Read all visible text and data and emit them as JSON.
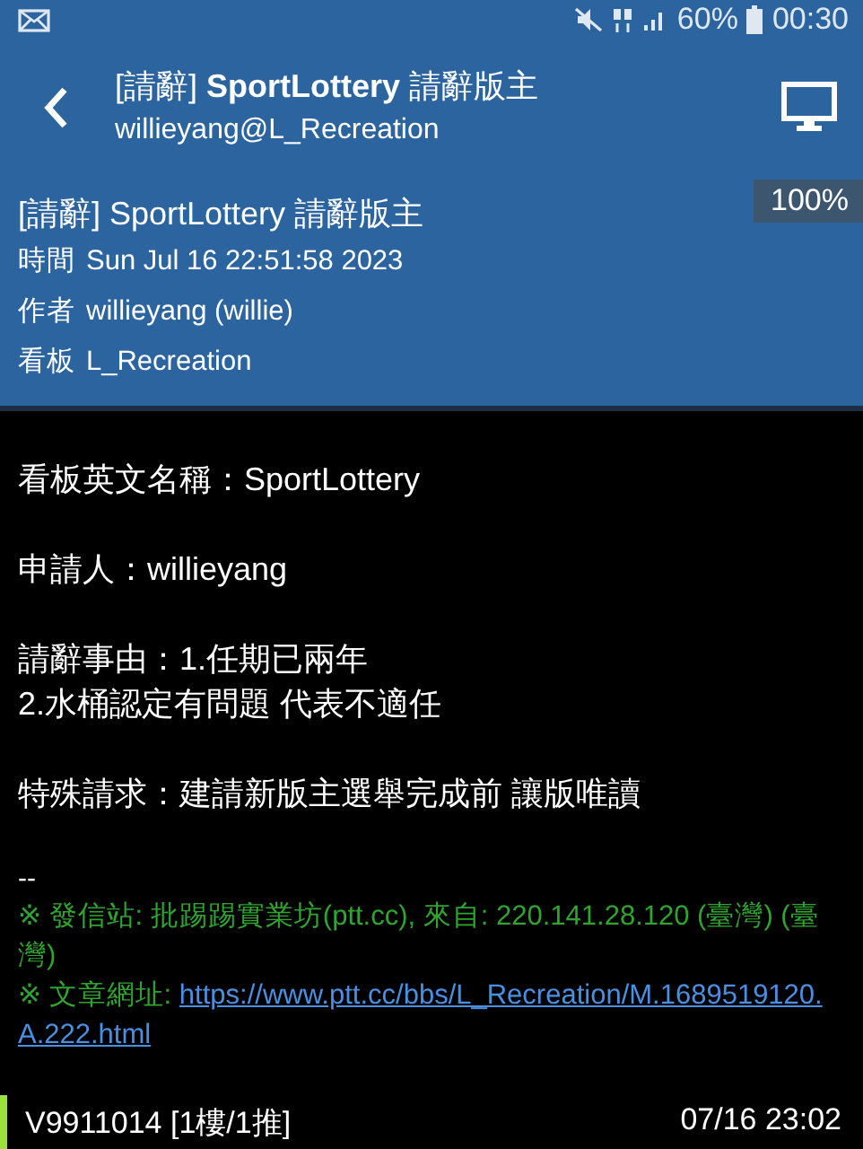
{
  "status_bar": {
    "battery": "60%",
    "time": "00:30"
  },
  "app_bar": {
    "title": "[請辭] **SportLottery** 請辭版主",
    "subtitle": "willieyang@L_Recreation"
  },
  "article_header": {
    "title": "[請辭] SportLottery 請辭版主",
    "zoom": "100%",
    "fields": [
      {
        "label": "時間",
        "value": "Sun Jul 16 22:51:58 2023"
      },
      {
        "label": "作者",
        "value": "willieyang (willie)"
      },
      {
        "label": "看板",
        "value": "L_Recreation"
      }
    ]
  },
  "body": {
    "paragraphs": [
      [
        "看板英文名稱：SportLottery"
      ],
      [
        "申請人：willieyang"
      ],
      [
        "請辭事由：1.任期已兩年",
        "2.水桶認定有問題 代表不適任"
      ],
      [
        "特殊請求：建請新版主選舉完成前 讓版唯讀"
      ]
    ]
  },
  "signature": {
    "separator": "--",
    "lines": [
      {
        "kind": "text",
        "text": "※ 發信站: 批踢踢實業坊(ptt.cc), 來自: 220.141.28.120 (臺灣) (臺灣)"
      },
      {
        "kind": "link",
        "label": "※ 文章網址:",
        "url": "https://www.ptt.cc/bbs/L_Recreation/M.1689519120.A.222.html"
      }
    ]
  },
  "footer": {
    "author": "V9911014 [1樓/1推]",
    "time": "07/16 23:02"
  }
}
